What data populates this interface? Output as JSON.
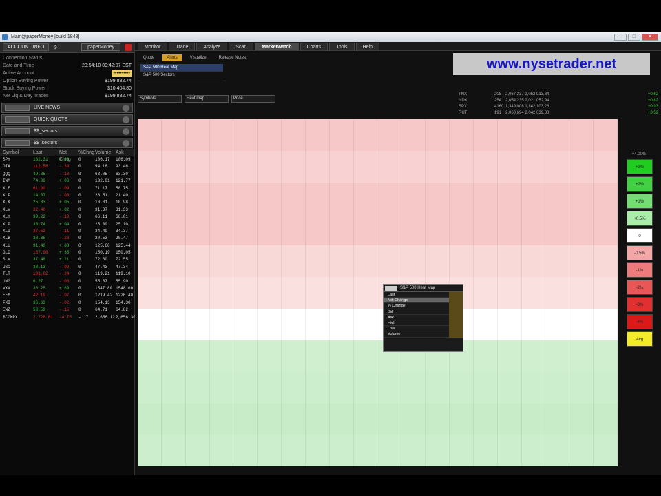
{
  "window": {
    "title": "Main@paperMoney [build 1848]"
  },
  "account": {
    "header_label": "ACCOUNT INFO",
    "account_select": "paperMoney",
    "rows": [
      {
        "label": "Connection Status",
        "value": ""
      },
      {
        "label": "Date and Time",
        "value": "20:54:10 09:42:07 EST"
      },
      {
        "label": "Active Account",
        "value": "••••••••••"
      },
      {
        "label": "Option Buying Power",
        "value": "$199,882.74"
      },
      {
        "label": "Stock Buying Power",
        "value": "$10,404.80"
      },
      {
        "label": "Net Liq & Day Trades",
        "value": "$199,882.74"
      }
    ]
  },
  "gadgets": [
    "LIVE NEWS",
    "QUICK QUOTE",
    "$$_sectors",
    "$$_sectors"
  ],
  "watchlist": {
    "headers": [
      "Symbol",
      "Last",
      "Net Chng",
      "%Chng",
      "Volume",
      "Ask"
    ],
    "rows": [
      [
        "SPY",
        "132.31",
        "+.03",
        "0",
        "106.17",
        "106.09"
      ],
      [
        "DIA",
        "112.58",
        "-.30",
        "0",
        "94.18",
        "93.46"
      ],
      [
        "QQQ",
        "49.36",
        "-.18",
        "0",
        "63.05",
        "63.30"
      ],
      [
        "IWM",
        "74.09",
        "+.06",
        "0",
        "132.01",
        "121.77"
      ],
      [
        "XLE",
        "61.90",
        "-.09",
        "0",
        "71.17",
        "58.75"
      ],
      [
        "XLF",
        "14.07",
        "-.03",
        "0",
        "26.51",
        "21.40"
      ],
      [
        "XLK",
        "25.83",
        "+.05",
        "0",
        "10.01",
        "10.98"
      ],
      [
        "XLV",
        "32.46",
        "+.02",
        "0",
        "31.37",
        "31.33"
      ],
      [
        "XLY",
        "39.22",
        "-.19",
        "0",
        "66.11",
        "66.01"
      ],
      [
        "XLP",
        "30.74",
        "+.04",
        "0",
        "25.09",
        "25.10"
      ],
      [
        "XLI",
        "37.53",
        "-.11",
        "0",
        "34.49",
        "34.37"
      ],
      [
        "XLB",
        "38.35",
        "-.23",
        "0",
        "20.53",
        "20.47"
      ],
      [
        "XLU",
        "31.40",
        "+.08",
        "0",
        "125.68",
        "125.44"
      ],
      [
        "GLD",
        "157.96",
        "+.35",
        "0",
        "150.19",
        "150.05"
      ],
      [
        "SLV",
        "37.48",
        "+.21",
        "0",
        "72.80",
        "72.55"
      ],
      [
        "USO",
        "38.13",
        "-.09",
        "0",
        "47.43",
        "47.34"
      ],
      [
        "TLT",
        "101.82",
        "-.24",
        "0",
        "119.21",
        "119.10"
      ],
      [
        "UNG",
        "6.27",
        "-.03",
        "0",
        "55.87",
        "55.90"
      ],
      [
        "VXX",
        "33.25",
        "+.60",
        "0",
        "1547.80",
        "1548.00"
      ],
      [
        "EEM",
        "42.19",
        "-.07",
        "0",
        "1219.42",
        "1226.40"
      ],
      [
        "FXI",
        "36.63",
        "-.02",
        "0",
        "154.13",
        "154.30"
      ],
      [
        "EWZ",
        "58.59",
        "-.15",
        "0",
        "64.71",
        "64.82"
      ],
      [
        "$COMPX",
        "2,728.81",
        "-4.75",
        "-.17",
        "2,656.12",
        "2,656.30"
      ]
    ]
  },
  "tabs": [
    "Monitor",
    "Trade",
    "Analyze",
    "Scan",
    "MarketWatch",
    "Charts",
    "Tools",
    "Help"
  ],
  "active_tab": "MarketWatch",
  "subtabs": [
    "Quote",
    "Alerts",
    "Visualize",
    "Release Notes"
  ],
  "sublist": [
    "S&P 500 Heat Map",
    "S&P 500 Sectors"
  ],
  "filters": [
    "Symbols",
    "Heat map",
    "Price"
  ],
  "watermark": "www.nysetrader.net",
  "quote": [
    {
      "label": "TNX",
      "x": "208",
      "bar": "2,067,237 2,052,913,84",
      "chg": "+0.62"
    },
    {
      "label": "NDX",
      "x": "254",
      "bar": "2,054,235 2,021,052,94",
      "chg": "+0.82"
    },
    {
      "label": "SPX",
      "x": "4160",
      "bar": "1,349,008 1,342,103,26",
      "chg": "+0.93"
    },
    {
      "label": "RUT",
      "x": "191",
      "bar": "2,060,694 2,042,039,88",
      "chg": "+0.52"
    }
  ],
  "popup": {
    "title": "S&P 500 Heat Map",
    "rows": [
      "Last",
      "Net Change",
      "% Change",
      "Bid",
      "Ask",
      "High",
      "Low",
      "Volume"
    ],
    "highlighted": "Net Change"
  },
  "legend": {
    "header": "+4.00%",
    "levels": [
      "+3%",
      "+2%",
      "+1%",
      "+0.5%",
      "0",
      "-0.5%",
      "-1%",
      "-2%",
      "-3%",
      "-4%"
    ],
    "colors": [
      "#1fcc1f",
      "#44d044",
      "#74dd74",
      "#a8eea8",
      "#ffffff",
      "#f2a6a6",
      "#ee7b7b",
      "#e85656",
      "#e03030",
      "#dd1818"
    ],
    "footer": "Avg"
  },
  "heatmap": {
    "columns": 20,
    "row_colors": [
      "#f6c8c8",
      "#f6c8c8",
      "#f6c8c8",
      "#f8d2d2",
      "#f8d2d2",
      "#f8d2d2",
      "#f6c8c8",
      "#f6c8c8",
      "#f6c8c8",
      "#f6c8c8",
      "#f6c8c8",
      "#f6c8c8",
      "#f9d8d8",
      "#f9d8d8",
      "#f9d8d8",
      "#fbe0e0",
      "#fbe0e0",
      "#fbe0e0",
      "#ffffff",
      "#ffffff",
      "#ffffff",
      "#cfefcf",
      "#cfefcf",
      "#cfefcf",
      "#cdeecd",
      "#cdeecd",
      "#cdeecd",
      "#c8ecc8",
      "#c8ecc8",
      "#c8ecc8",
      "#cdeecd",
      "#cdeecd",
      "#cdeecd"
    ]
  }
}
